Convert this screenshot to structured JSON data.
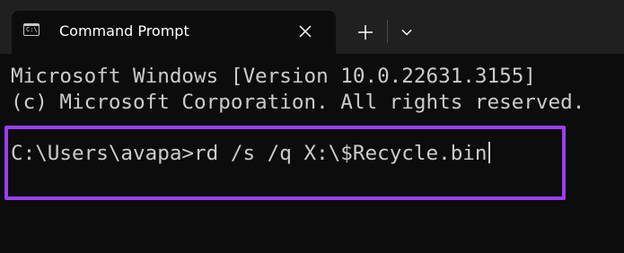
{
  "window": {
    "tab_icon_glyph": "C:\\",
    "tab_title": "Command Prompt",
    "icons": {
      "tab_close": "close-icon",
      "new_tab": "plus-icon",
      "dropdown": "chevron-down-icon"
    }
  },
  "terminal": {
    "line_1": "Microsoft Windows [Version 10.0.22631.3155]",
    "line_2": "(c) Microsoft Corporation. All rights reserved.",
    "prompt": "C:\\Users\\avapa>",
    "command": "rd /s /q X:\\$Recycle.bin"
  },
  "colors": {
    "background": "#0c0c0c",
    "titlebar": "#202020",
    "text": "#cccccc",
    "highlight_border": "#9b3ef0"
  }
}
